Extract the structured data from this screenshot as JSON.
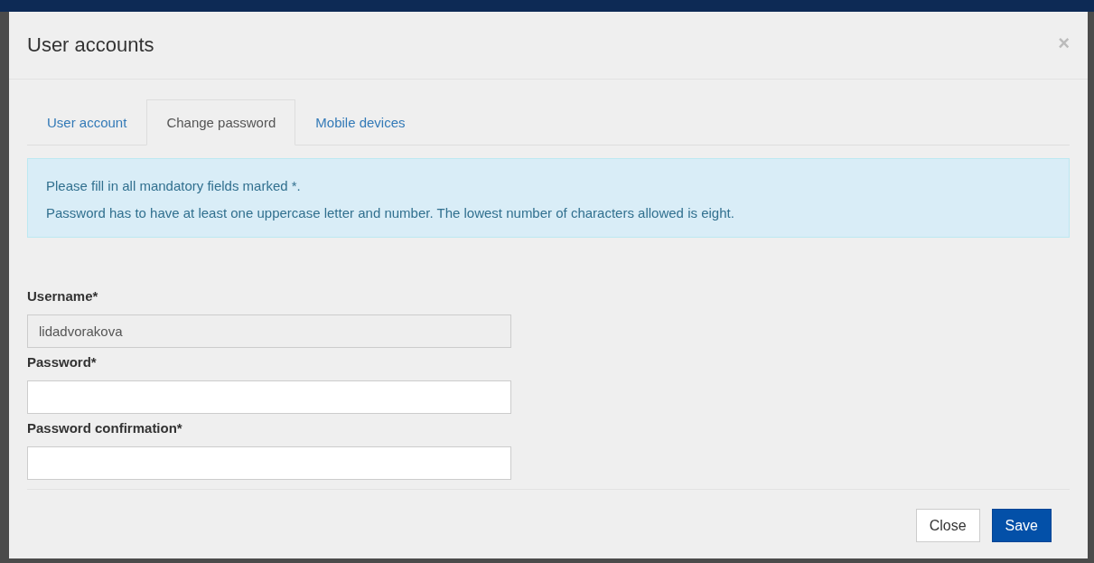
{
  "dialog": {
    "title": "User accounts",
    "close_glyph": "×"
  },
  "tabs": [
    {
      "label": "User account",
      "selected": false
    },
    {
      "label": "Change password",
      "selected": true
    },
    {
      "label": "Mobile devices",
      "selected": false
    }
  ],
  "notice": [
    "Please fill in all mandatory fields marked *.",
    "Password has to have at least one uppercase letter and number. The lowest number of characters allowed is eight."
  ],
  "fields": [
    {
      "label": "Username*",
      "value": "lidadvorakova",
      "disabled": true
    },
    {
      "label": "Password*",
      "disabled": false
    },
    {
      "label": "Password confirmation*",
      "disabled": false
    }
  ],
  "buttons": [
    {
      "label": "Close",
      "kind": "default"
    },
    {
      "label": "Save",
      "kind": "primary"
    }
  ]
}
